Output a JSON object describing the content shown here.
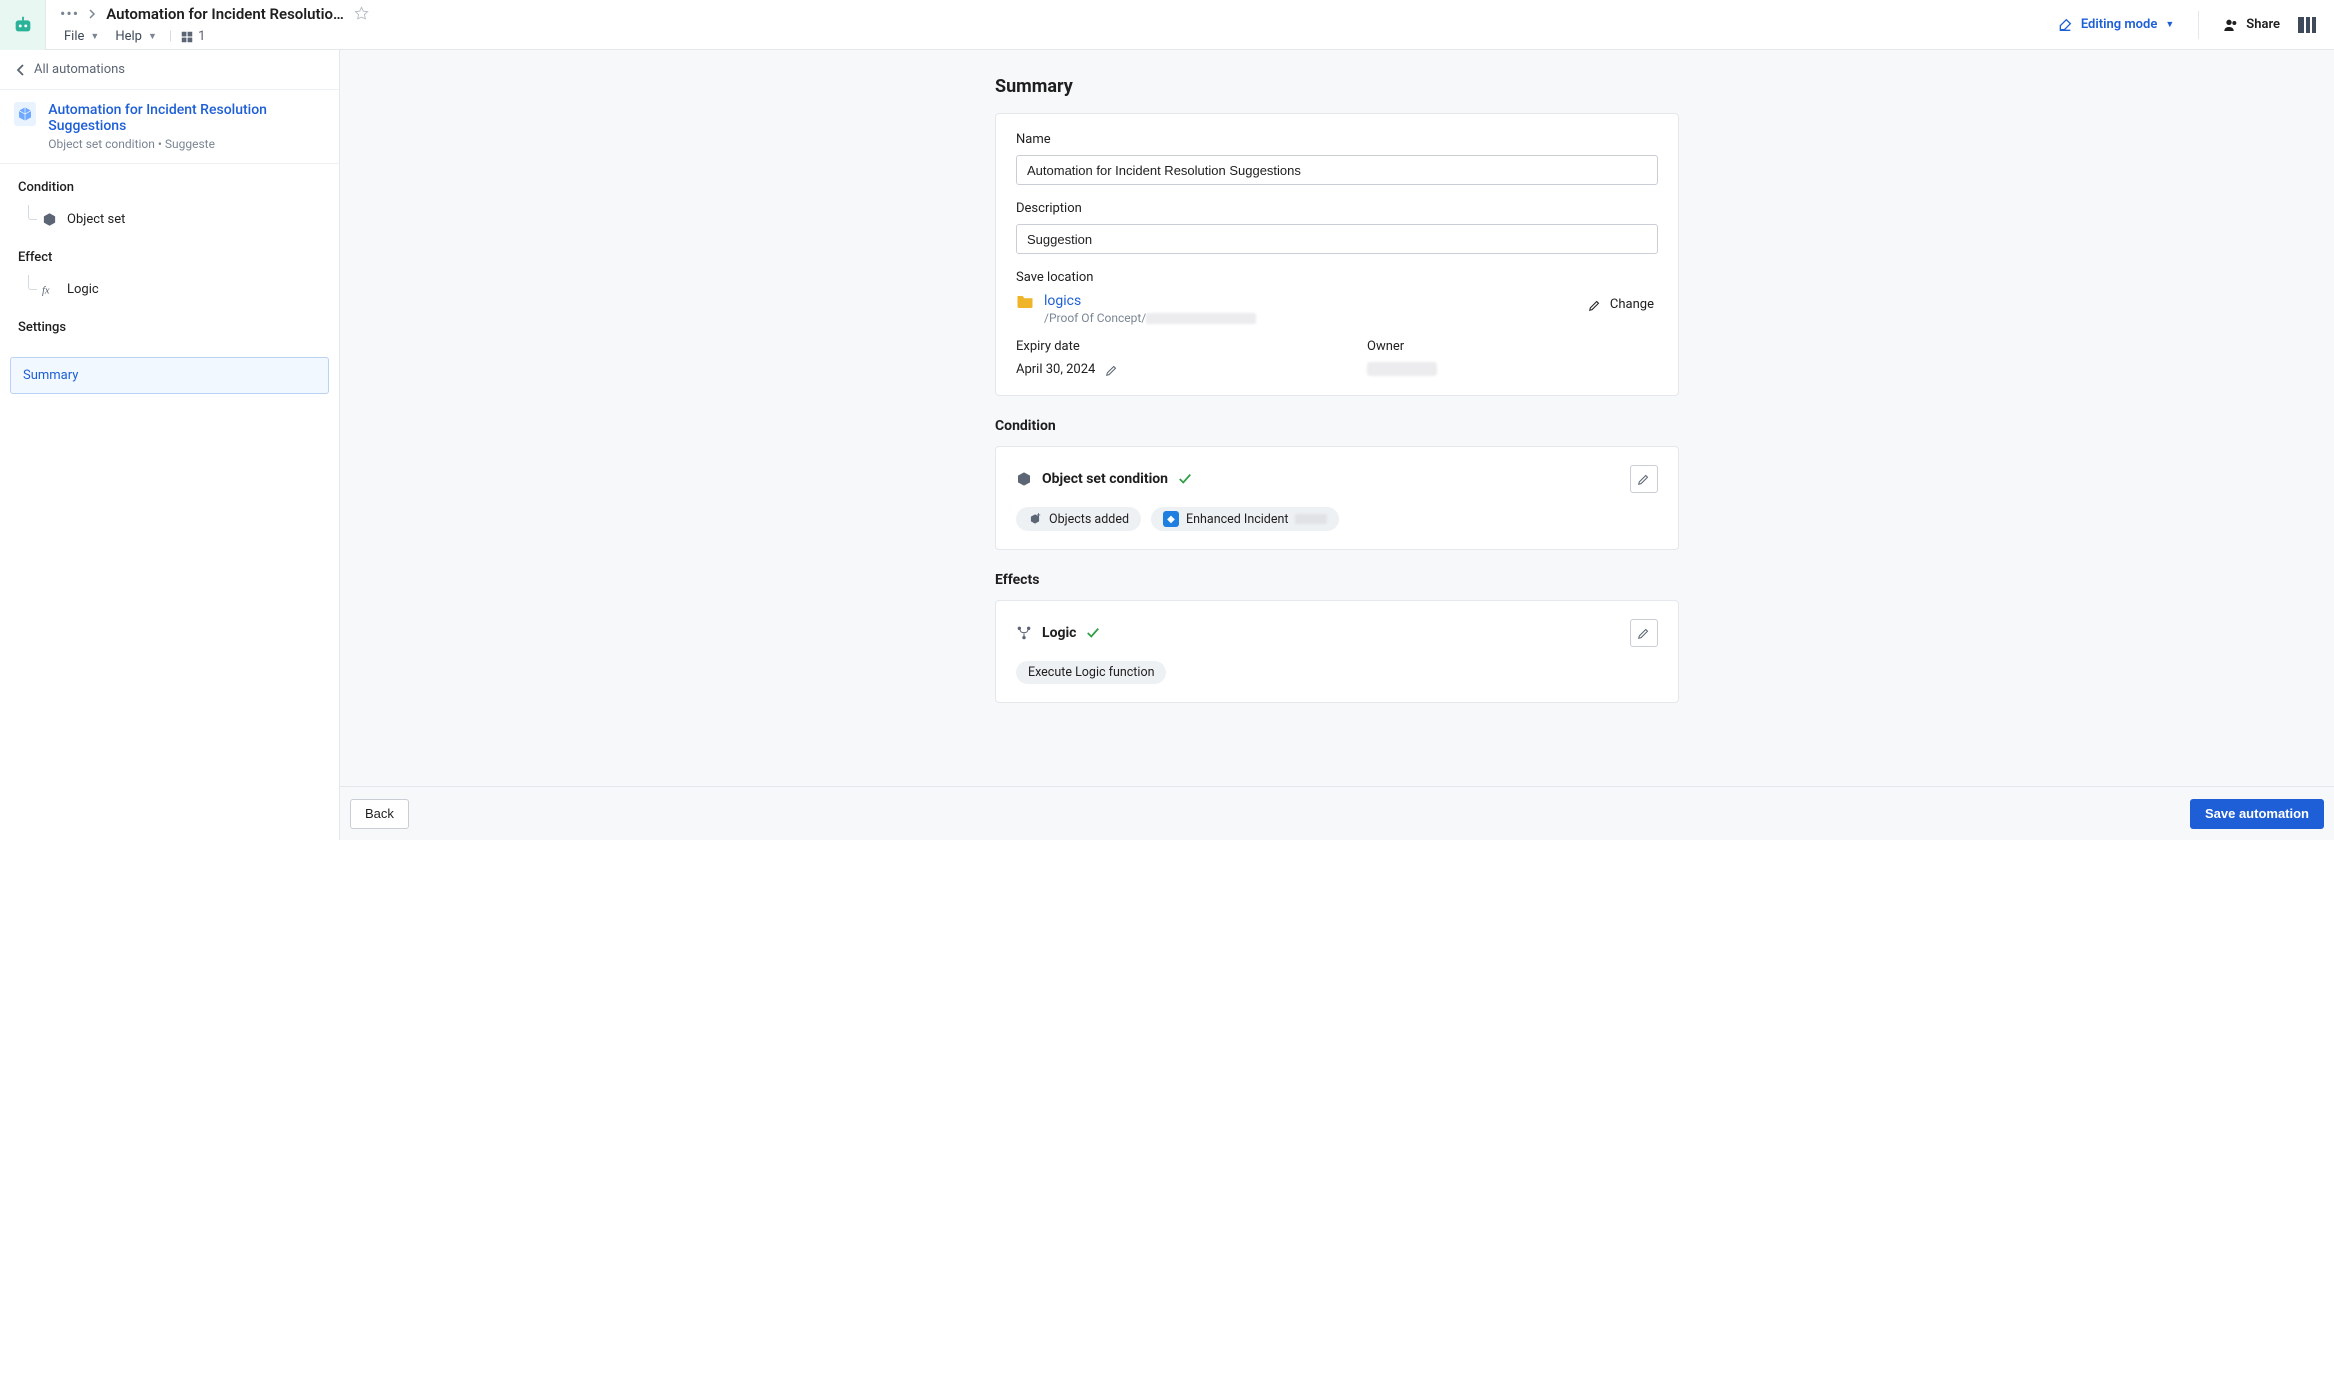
{
  "topbar": {
    "title": "Automation for Incident Resolutio…",
    "menu": {
      "file": "File",
      "help": "Help"
    },
    "presence_count": "1",
    "mode_label": "Editing mode",
    "share_label": "Share"
  },
  "sidebar": {
    "back_label": "All automations",
    "automation": {
      "title": "Automation for Incident Resolution Suggestions",
      "subtitle": "Object set condition • Suggeste"
    },
    "sections": {
      "condition": {
        "head": "Condition",
        "item": "Object set"
      },
      "effect": {
        "head": "Effect",
        "item": "Logic"
      },
      "settings": {
        "head": "Settings",
        "summary": "Summary"
      }
    }
  },
  "main": {
    "page_title": "Summary",
    "name_label": "Name",
    "name_value": "Automation for Incident Resolution Suggestions",
    "desc_label": "Description",
    "desc_value": "Suggestion",
    "save_loc_label": "Save location",
    "save_loc_name": "logics",
    "save_loc_path": "/Proof Of Concept/",
    "change_label": "Change",
    "expiry_label": "Expiry date",
    "expiry_value": "April 30, 2024",
    "owner_label": "Owner",
    "condition_title": "Condition",
    "condition_name": "Object set condition",
    "tag_objects_added": "Objects added",
    "tag_enhanced_incident": "Enhanced Incident",
    "effects_title": "Effects",
    "effect_name": "Logic",
    "tag_execute": "Execute Logic function"
  },
  "footer": {
    "back": "Back",
    "save": "Save automation"
  }
}
